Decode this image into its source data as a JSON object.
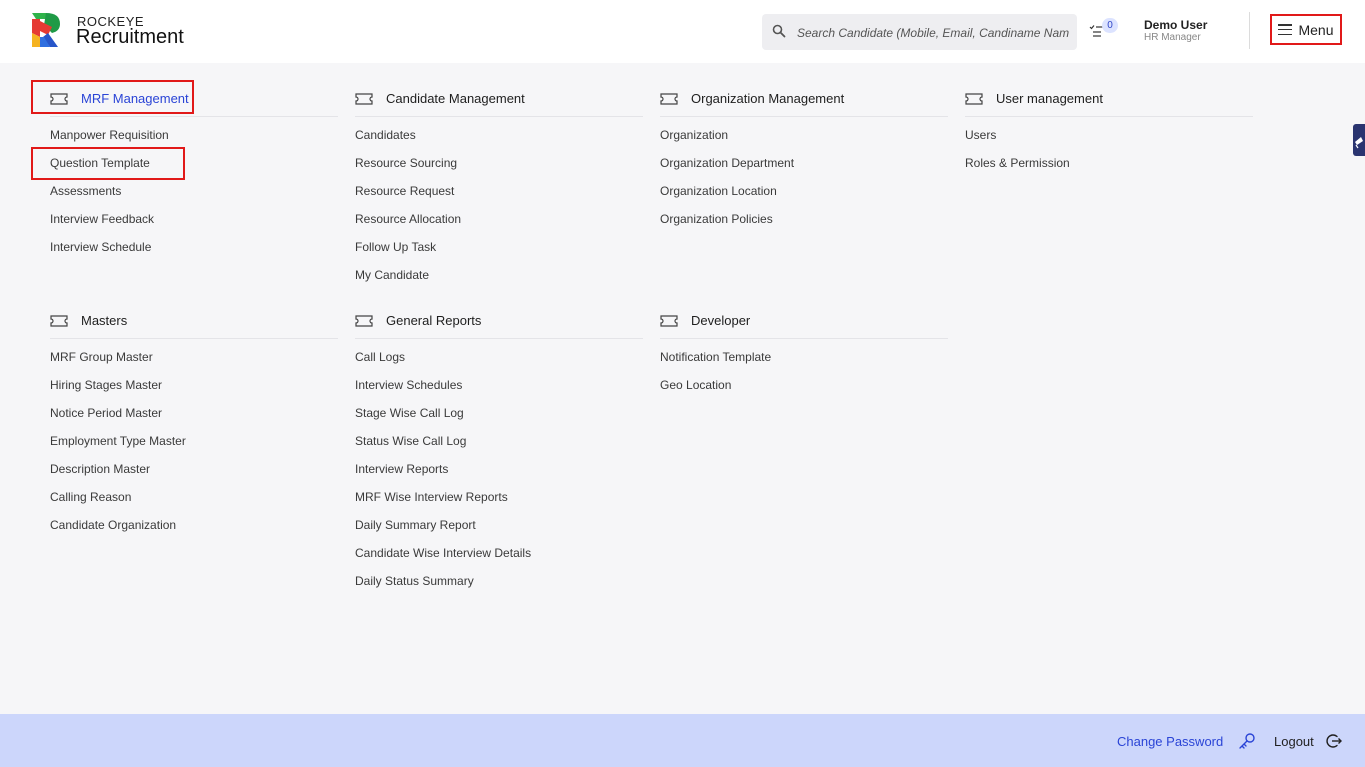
{
  "brand": {
    "top": "ROCKEYE",
    "main": "Recruitment"
  },
  "search": {
    "placeholder": "Search Candidate (Mobile, Email, Candiname Name)"
  },
  "tasks": {
    "count": "0"
  },
  "user": {
    "name": "Demo User",
    "role": "HR Manager"
  },
  "menu_label": "Menu",
  "sections": [
    {
      "title": "MRF Management",
      "items": [
        "Manpower Requisition",
        "Question Template",
        "Assessments",
        "Interview Feedback",
        "Interview Schedule"
      ]
    },
    {
      "title": "Candidate Management",
      "items": [
        "Candidates",
        "Resource Sourcing",
        "Resource Request",
        "Resource Allocation",
        "Follow Up Task",
        "My Candidate"
      ]
    },
    {
      "title": "Organization Management",
      "items": [
        "Organization",
        "Organization Department",
        "Organization Location",
        "Organization Policies"
      ]
    },
    {
      "title": "User management",
      "items": [
        "Users",
        "Roles & Permission"
      ]
    },
    {
      "title": "Masters",
      "items": [
        "MRF Group Master",
        "Hiring Stages Master",
        "Notice Period Master",
        "Employment Type Master",
        "Description Master",
        "Calling Reason",
        "Candidate Organization"
      ]
    },
    {
      "title": "General Reports",
      "items": [
        "Call Logs",
        "Interview Schedules",
        "Stage Wise Call Log",
        "Status Wise Call Log",
        "Interview Reports",
        "MRF Wise Interview Reports",
        "Daily Summary Report",
        "Candidate Wise Interview Details",
        "Daily Status Summary"
      ]
    },
    {
      "title": "Developer",
      "items": [
        "Notification Template",
        "Geo Location"
      ]
    }
  ],
  "footer": {
    "change_password": "Change Password",
    "logout": "Logout"
  },
  "colors": {
    "accent": "#2a44d6",
    "highlight": "#e11919",
    "footer_bg": "#ccd6fb"
  }
}
